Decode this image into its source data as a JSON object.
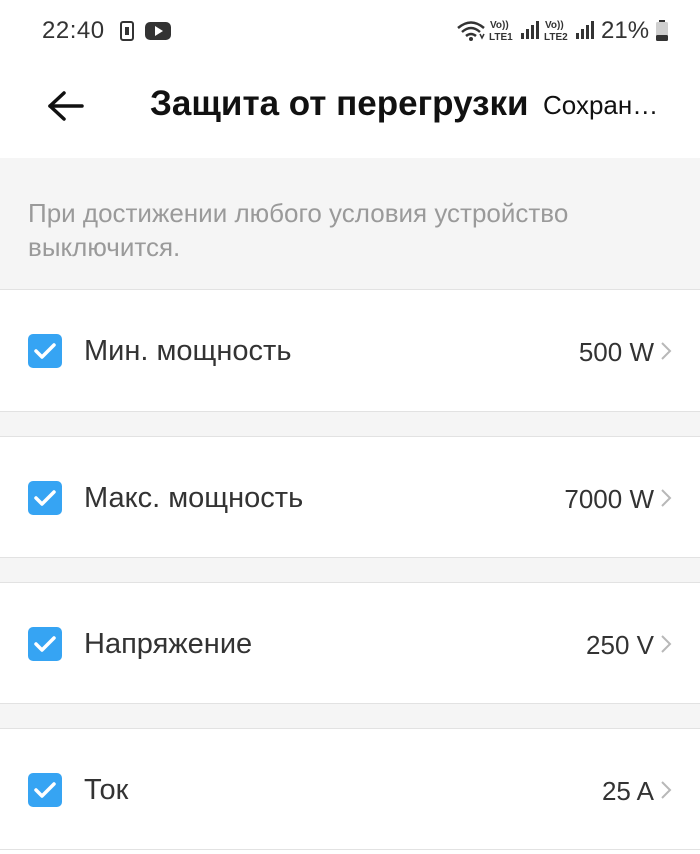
{
  "status_bar": {
    "time": "22:40",
    "battery_percent": "21%",
    "volte1": {
      "top": "Vo))",
      "bottom": "LTE1"
    },
    "volte2": {
      "top": "Vo))",
      "bottom": "LTE2"
    },
    "icons": [
      "sim-card-icon",
      "youtube-icon",
      "wifi-icon",
      "volte-icon",
      "signal-icon",
      "battery-icon"
    ]
  },
  "app_bar": {
    "title": "Защита от перегрузки",
    "save_label": "Сохранить",
    "back_icon": "arrow-left-icon"
  },
  "info": {
    "text": "При достижении любого условия устройство выключится."
  },
  "conditions": [
    {
      "label": "Мин. мощность",
      "value": "500 W",
      "checked": true
    },
    {
      "label": "Макс. мощность",
      "value": "7000 W",
      "checked": true
    },
    {
      "label": "Напряжение",
      "value": "250 V",
      "checked": true
    },
    {
      "label": "Ток",
      "value": "25 A",
      "checked": true
    }
  ],
  "colors": {
    "accent": "#36a4f3",
    "panel_background": "#f5f5f5",
    "hint_text": "#9a9a9a",
    "divider": "#e2e2e2"
  }
}
